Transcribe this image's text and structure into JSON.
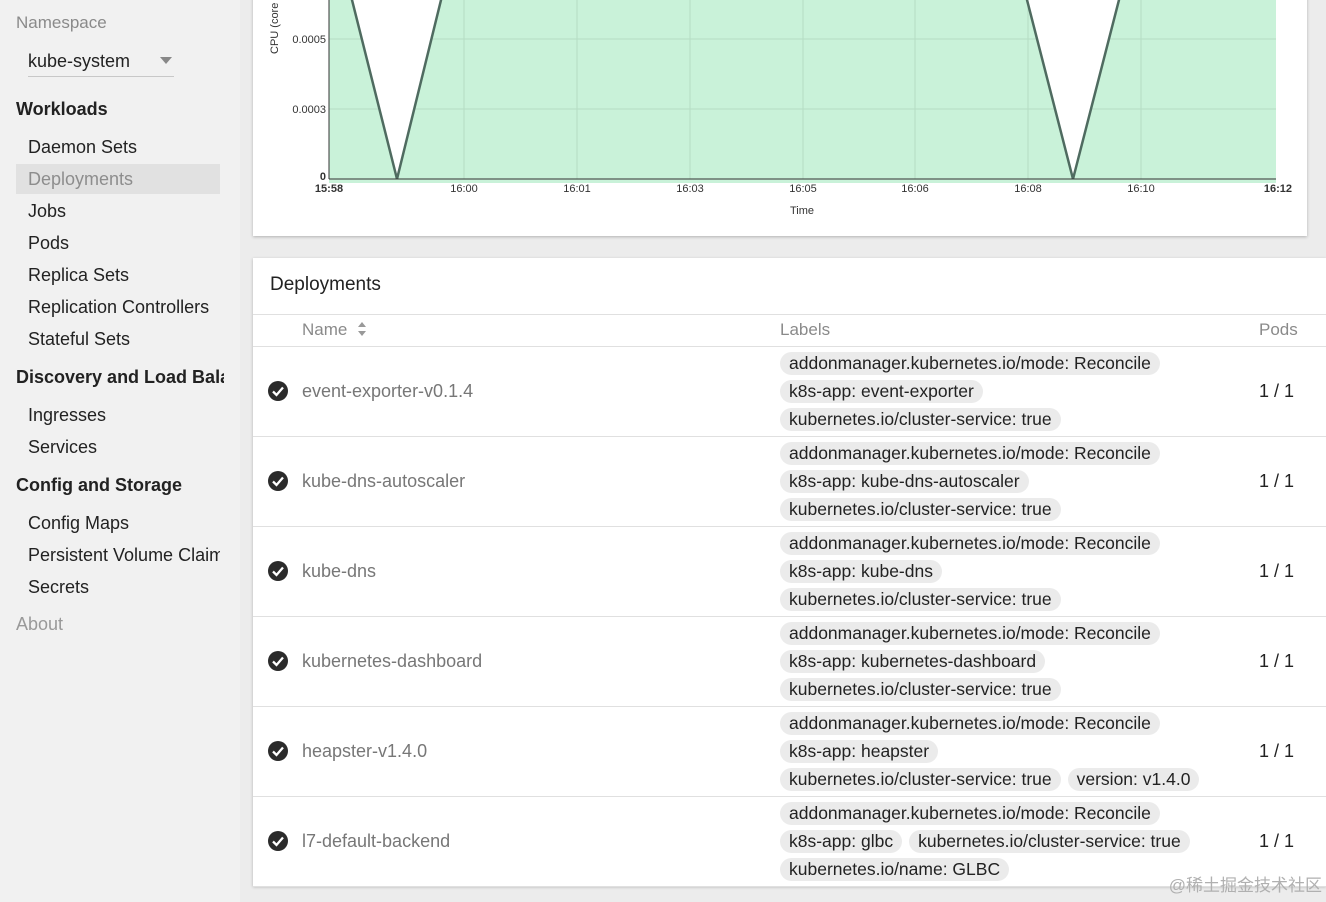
{
  "sidebar": {
    "namespace_label": "Namespace",
    "namespace_value": "kube-system",
    "sections": {
      "workloads": "Workloads",
      "discovery": "Discovery and Load Balar",
      "config": "Config and Storage"
    },
    "items": {
      "daemon_sets": "Daemon Sets",
      "deployments": "Deployments",
      "jobs": "Jobs",
      "pods": "Pods",
      "replica_sets": "Replica Sets",
      "replication_controllers": "Replication Controllers",
      "stateful_sets": "Stateful Sets",
      "ingresses": "Ingresses",
      "services": "Services",
      "config_maps": "Config Maps",
      "pvc": "Persistent Volume Claim",
      "secrets": "Secrets"
    },
    "about": "About"
  },
  "chart_data": {
    "type": "area",
    "ylabel": "CPU (core",
    "xlabel": "Time",
    "x_ticks": [
      "15:58",
      "16:00",
      "16:01",
      "16:03",
      "16:05",
      "16:06",
      "16:08",
      "16:10",
      "16:12"
    ],
    "y_ticks": [
      "0",
      "0.0003",
      "0.0005"
    ],
    "fill_color": "#c9f2d9",
    "line_color": "#4f6b60",
    "note": "area chart with two dips to 0 near 15:59 and 16:09"
  },
  "deployments": {
    "title": "Deployments",
    "columns": {
      "name": "Name",
      "labels": "Labels",
      "pods": "Pods"
    },
    "rows": [
      {
        "name": "event-exporter-v0.1.4",
        "labels": [
          [
            "addonmanager.kubernetes.io/mode: Reconcile"
          ],
          [
            "k8s-app: event-exporter"
          ],
          [
            "kubernetes.io/cluster-service: true"
          ]
        ],
        "pods": "1 / 1"
      },
      {
        "name": "kube-dns-autoscaler",
        "labels": [
          [
            "addonmanager.kubernetes.io/mode: Reconcile"
          ],
          [
            "k8s-app: kube-dns-autoscaler"
          ],
          [
            "kubernetes.io/cluster-service: true"
          ]
        ],
        "pods": "1 / 1"
      },
      {
        "name": "kube-dns",
        "labels": [
          [
            "addonmanager.kubernetes.io/mode: Reconcile"
          ],
          [
            "k8s-app: kube-dns"
          ],
          [
            "kubernetes.io/cluster-service: true"
          ]
        ],
        "pods": "1 / 1"
      },
      {
        "name": "kubernetes-dashboard",
        "labels": [
          [
            "addonmanager.kubernetes.io/mode: Reconcile"
          ],
          [
            "k8s-app: kubernetes-dashboard"
          ],
          [
            "kubernetes.io/cluster-service: true"
          ]
        ],
        "pods": "1 / 1"
      },
      {
        "name": "heapster-v1.4.0",
        "labels": [
          [
            "addonmanager.kubernetes.io/mode: Reconcile"
          ],
          [
            "k8s-app: heapster"
          ],
          [
            "kubernetes.io/cluster-service: true",
            "version: v1.4.0"
          ]
        ],
        "pods": "1 / 1"
      },
      {
        "name": "l7-default-backend",
        "labels": [
          [
            "addonmanager.kubernetes.io/mode: Reconcile"
          ],
          [
            "k8s-app: glbc",
            "kubernetes.io/cluster-service: true"
          ],
          [
            "kubernetes.io/name: GLBC"
          ]
        ],
        "pods": "1 / 1"
      }
    ]
  },
  "watermark": "@稀土掘金技术社区"
}
